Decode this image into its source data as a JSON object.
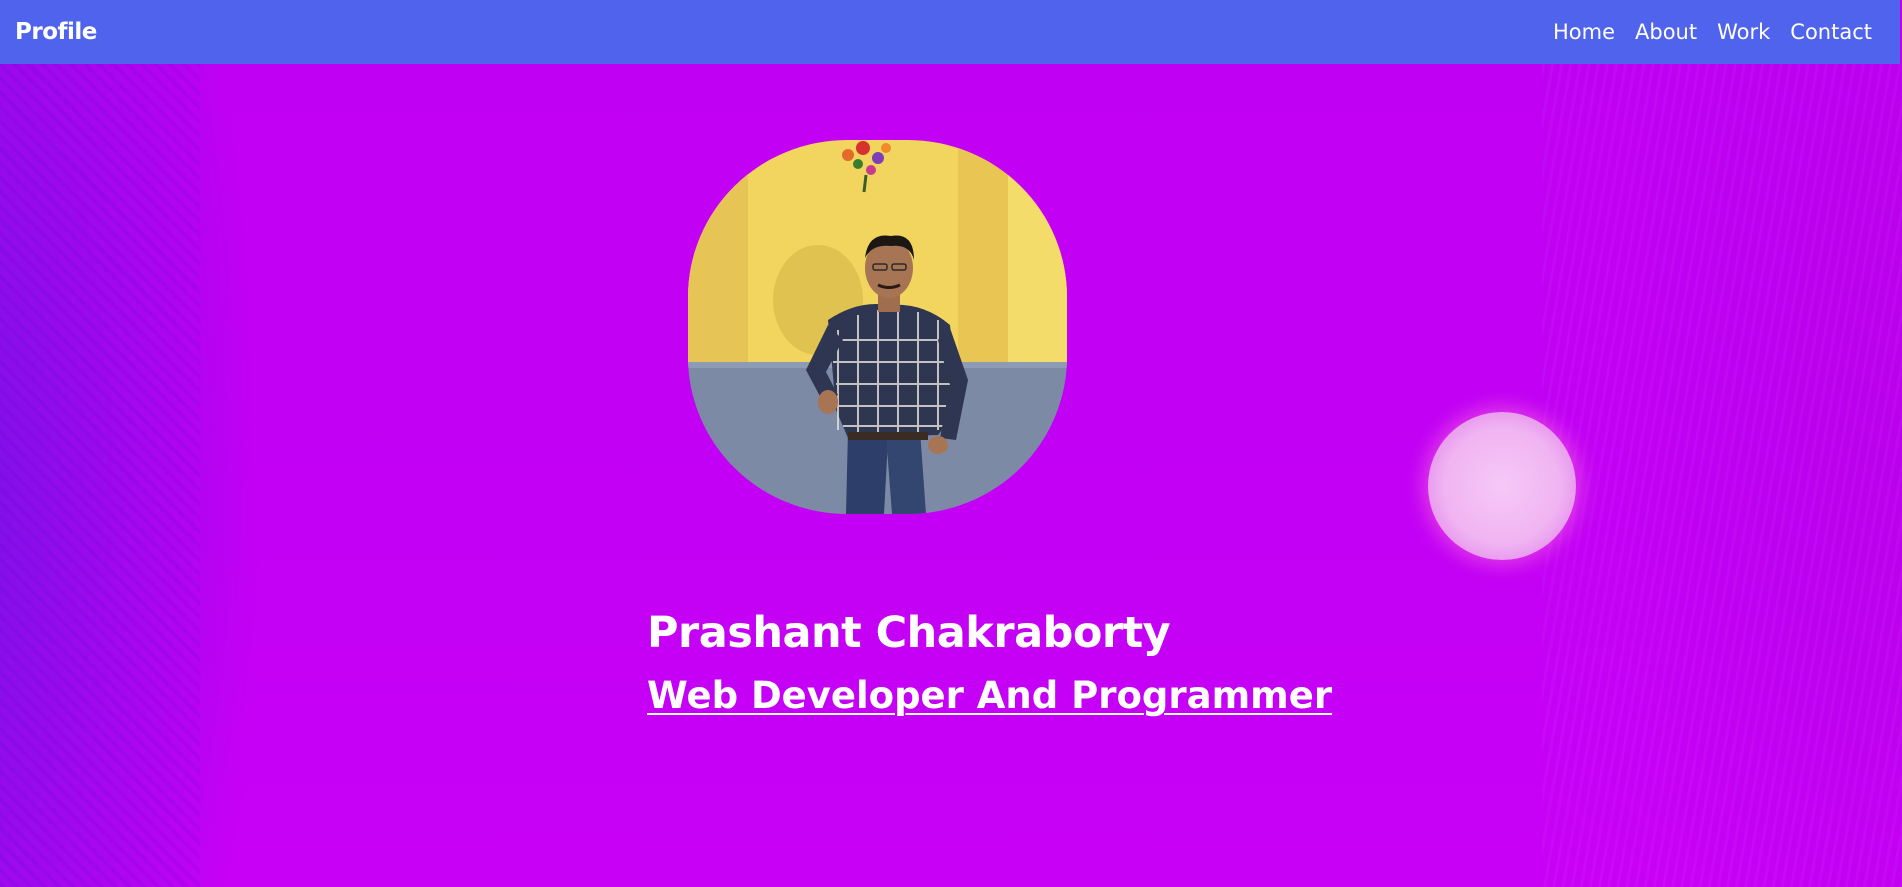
{
  "navbar": {
    "brand": "Profile",
    "links": [
      "Home",
      "About",
      "Work",
      "Contact"
    ]
  },
  "hero": {
    "name": "Prashant Chakraborty",
    "role": "Web Developer And Programmer"
  },
  "colors": {
    "navbar": "#4f63ec",
    "background": "#c300f5",
    "text": "#ffffff",
    "bubble": "#f4c2f5"
  }
}
